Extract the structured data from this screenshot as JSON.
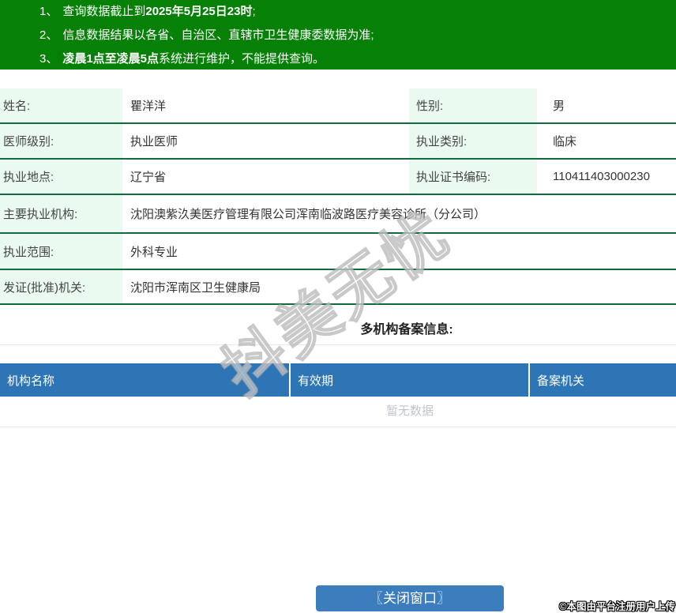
{
  "notice": {
    "lines": [
      {
        "num": "1、",
        "pre": "查询数据截止到",
        "bold": "2025年5月25日23时",
        "post": ";"
      },
      {
        "num": "2、",
        "pre": "信息数据结果以各省、自治区、直辖市卫生健康委数据为准;",
        "bold": "",
        "post": ""
      },
      {
        "num": "3、",
        "pre": "",
        "bold": "凌晨1点至凌晨5点",
        "post": "系统进行维护，不能提供查询。"
      }
    ]
  },
  "doctor": {
    "row1": {
      "l1": "姓名:",
      "v1": "瞿洋洋",
      "l2": "性别:",
      "v2": "男"
    },
    "row2": {
      "l1": "医师级别:",
      "v1": "执业医师",
      "l2": "执业类别:",
      "v2": "临床"
    },
    "row3": {
      "l1": "执业地点:",
      "v1": "辽宁省",
      "l2": "执业证书编码:",
      "v2": "110411403000230"
    },
    "row4": {
      "l1": "主要执业机构:",
      "v1": "沈阳澳紫汣美医疗管理有限公司浑南临波路医疗美容诊所（分公司）"
    },
    "row5": {
      "l1": "执业范围:",
      "v1": "外科专业"
    },
    "row6": {
      "l1": "发证(批准)机关:",
      "v1": "沈阳市浑南区卫生健康局"
    }
  },
  "filing": {
    "heading": "多机构备案信息:",
    "columns": [
      "机构名称",
      "有效期",
      "备案机关"
    ],
    "empty_text": "暂无数据"
  },
  "footer": {
    "close_button": "〖关闭窗口〗",
    "attribution": "©本图由平台注册用户上传"
  },
  "watermark": "抖美无忧",
  "colors": {
    "banner_green": "#078007",
    "row_border_green": "#116b3f",
    "label_bg_mint": "#eafaf1",
    "table_header_blue": "#2e75b5",
    "button_blue": "#3b7dbd",
    "nodata_gray": "#c0c4cc"
  }
}
